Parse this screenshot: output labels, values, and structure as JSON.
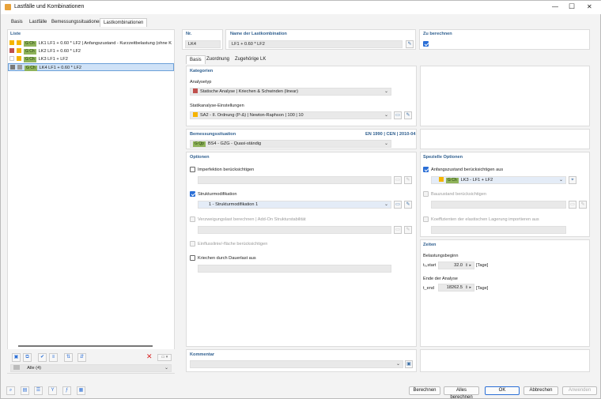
{
  "window": {
    "title": "Lastfälle und Kombinationen",
    "min": "—",
    "max": "☐",
    "close": "✕"
  },
  "tabs": [
    "Basis",
    "Lastfälle",
    "Bemessungssituationen",
    "Lastkombinationen"
  ],
  "list": {
    "header": "Liste",
    "rows": [
      {
        "c1": "#f5b400",
        "c2": "#f5b400",
        "tag": "G Ch",
        "text": "LK1  LF1 + 0.60 * LF2 | Anfangszustand - Kurzzeitbelastung (ohne K"
      },
      {
        "c1": "#c0504d",
        "c2": "#f5b400",
        "tag": "G Ch",
        "text": "LK2  LF1 + 0.60 * LF2"
      },
      {
        "c1": "#ffffff",
        "c2": "#f5b400",
        "tag": "G Ch",
        "text": "LK3  LF1 + LF2"
      },
      {
        "c1": "#7a7a7a",
        "c2": "#9a9a9a",
        "tag": "G Ch",
        "text": "LK4  LF1 + 0.60 * LF2"
      }
    ],
    "filter": "Alle (4)"
  },
  "nr": {
    "label": "Nr.",
    "value": "LK4"
  },
  "name": {
    "label": "Name der Lastkombination",
    "value": "LF1 + 0.60 * LF2"
  },
  "calc": {
    "label": "Zu berechnen"
  },
  "subtabs": [
    "Basis",
    "Zuordnung",
    "Zugehörige LK"
  ],
  "kategorien": {
    "header": "Kategorien",
    "analysetyp_label": "Analysetyp",
    "analysetyp": "Statische Analyse | Kriechen & Schwinden (linear)",
    "statik_label": "Statikanalyse-Einstellungen",
    "statik": "SA2 - II. Ordnung (P-Δ) | Newton-Raphson | 100 | 10"
  },
  "bemessung": {
    "header": "Bemessungssituation",
    "norm": "EN 1990 | CEN | 2010-04",
    "tag": "G Qp",
    "value": "BS4 - GZG - Quasi-ständig"
  },
  "optionen": {
    "header": "Optionen",
    "imperfektion": "Imperfektion berücksichtigen",
    "strukturmod": "Strukturmodifikation",
    "strukturmod_value": "1 - Strukturmodifikation 1",
    "verzweigung": "Verzweigungslast berechnen | Add-On Strukturstabilität",
    "einfluss": "Einflusslinie/-fläche berücksichtigen",
    "kriechen": "Kriechen durch Dauerlast aus"
  },
  "spezial": {
    "header": "Spezielle Optionen",
    "anfang": "Anfangszustand berücksichtigen aus",
    "anfang_tag": "G Ch",
    "anfang_value": "LK3 - LF1 + LF2",
    "bauzustand": "Bauzustand berücksichtigen",
    "koeff": "Koeffizienten der elastischen Lagerung importieren aus"
  },
  "zeiten": {
    "header": "Zeiten",
    "beginn_label": "Belastungsbeginn",
    "t0_label": "t₀,start",
    "t0_value": "32.0",
    "t0_unit": "[Tage]",
    "ende_label": "Ende der Analyse",
    "tend_label": "t_end",
    "tend_value": "18262.5",
    "tend_unit": "[Tage]"
  },
  "kommentar": {
    "header": "Kommentar"
  },
  "buttons": {
    "berechnen": "Berechnen",
    "alle": "Alles berechnen",
    "ok": "OK",
    "abbrechen": "Abbrechen",
    "anwenden": "Anwenden"
  },
  "colors": {
    "accent": "#2b6fd6",
    "header": "#2f5f8f",
    "tag_green": "#8fb35a",
    "analysis_red": "#c0504d",
    "yellow": "#f5b400"
  }
}
